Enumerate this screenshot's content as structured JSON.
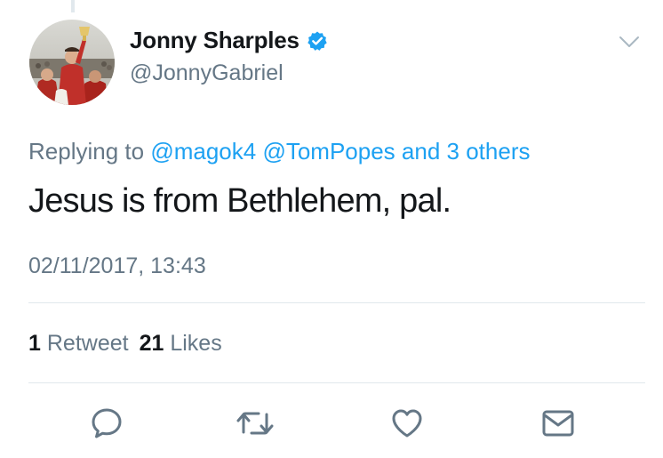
{
  "author": {
    "display_name": "Jonny Sharples",
    "handle": "@JonnyGabriel",
    "verified": true,
    "avatar_icon": "profile-photo-football-celebration"
  },
  "reply_context": {
    "prefix": "Replying to",
    "mentions": [
      "@magok4",
      "@TomPopes"
    ],
    "suffix": "and 3 others"
  },
  "tweet": {
    "text": "Jesus is from Bethlehem, pal.",
    "timestamp": "02/11/2017, 13:43"
  },
  "stats": {
    "retweets_count": "1",
    "retweets_label": "Retweet",
    "likes_count": "21",
    "likes_label": "Likes"
  },
  "actions": [
    {
      "name": "reply",
      "icon": "speech-bubble-icon"
    },
    {
      "name": "retweet",
      "icon": "retweet-arrows-icon"
    },
    {
      "name": "like",
      "icon": "heart-icon"
    },
    {
      "name": "direct-message",
      "icon": "envelope-icon"
    }
  ],
  "colors": {
    "link": "#1da1f2",
    "secondary_text": "#657786",
    "primary_text": "#14171a",
    "divider": "#e1e8ed",
    "action_icon": "#657786"
  }
}
